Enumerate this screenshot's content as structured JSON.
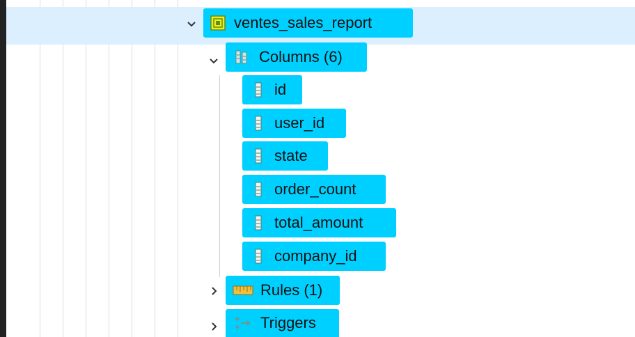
{
  "tree": {
    "view_node": {
      "label": "ventes_sales_report",
      "icon": "view-icon",
      "expanded": true
    },
    "columns_node": {
      "label": "Columns (6)",
      "icon": "columns-icon",
      "expanded": true
    },
    "columns": [
      {
        "label": "id",
        "icon": "column-icon"
      },
      {
        "label": "user_id",
        "icon": "column-icon"
      },
      {
        "label": "state",
        "icon": "column-icon"
      },
      {
        "label": "order_count",
        "icon": "column-icon"
      },
      {
        "label": "total_amount",
        "icon": "column-icon"
      },
      {
        "label": "company_id",
        "icon": "column-icon"
      }
    ],
    "rules_node": {
      "label": "Rules (1)",
      "icon": "rules-icon",
      "expanded": false
    },
    "triggers_node": {
      "label": "Triggers",
      "icon": "triggers-icon",
      "expanded": false
    }
  },
  "colors": {
    "selection": "#00d0ff",
    "row_highlight": "#dcefff",
    "view_icon": "#e8f020"
  }
}
